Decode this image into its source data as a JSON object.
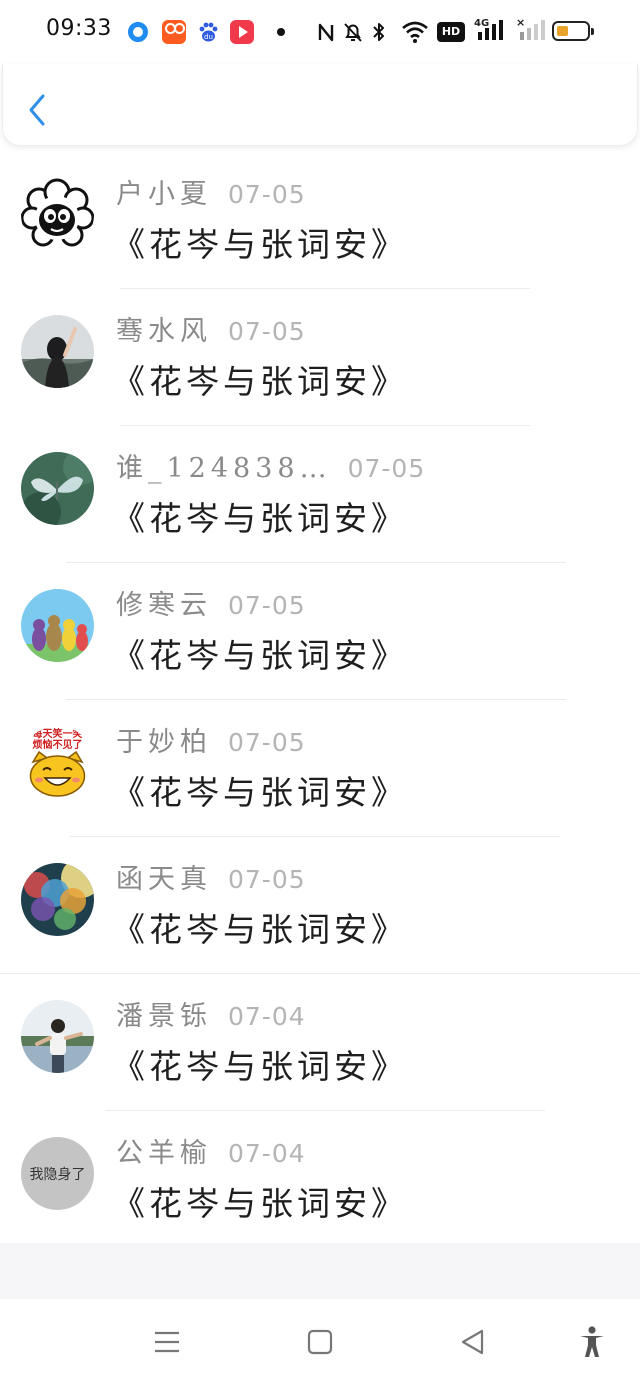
{
  "status_bar": {
    "time": "09:33",
    "icons": [
      "qq-browser-icon",
      "kuaishou-icon",
      "baidu-icon",
      "video-play-icon",
      "dot-icon",
      "nfc-icon",
      "mute-bell-icon",
      "bluetooth-icon",
      "wifi-icon",
      "hd-icon",
      "signal-4g-icon",
      "signal-no-sim-icon",
      "battery-icon"
    ],
    "hd_label": "HD",
    "network_label": "4G",
    "battery_level": 0.35,
    "battery_color": "#e8a42a"
  },
  "header": {
    "back_icon": "chevron-left-icon",
    "accent_color": "#2f8fe8"
  },
  "list": [
    {
      "name": "户小夏",
      "date": "07-05",
      "title": "《花岑与张词安》",
      "avatar": "sheep"
    },
    {
      "name": "骞水风",
      "date": "07-05",
      "title": "《花岑与张词安》",
      "avatar": "girl-sky"
    },
    {
      "name": "谁_124838…",
      "date": "07-05",
      "title": "《花岑与张词安》",
      "avatar": "butterfly"
    },
    {
      "name": "修寒云",
      "date": "07-05",
      "title": "《花岑与张词安》",
      "avatar": "teletubbies"
    },
    {
      "name": "于妙柏",
      "date": "07-05",
      "title": "《花岑与张词安》",
      "avatar": "smile-cat",
      "avatar_text": [
        "每天笑一笑",
        "烦恼不见了"
      ]
    },
    {
      "name": "函天真",
      "date": "07-05",
      "title": "《花岑与张词安》",
      "avatar": "balloons"
    },
    {
      "name": "潘景铄",
      "date": "07-04",
      "title": "《花岑与张词安》",
      "avatar": "boy-outdoor"
    },
    {
      "name": "公羊榆",
      "date": "07-04",
      "title": "《花岑与张词安》",
      "avatar": "hidden",
      "avatar_text": [
        "我隐身了"
      ]
    }
  ],
  "nav_bar": {
    "items": [
      "menu-icon",
      "home-square-icon",
      "back-triangle-icon",
      "accessibility-icon"
    ]
  }
}
